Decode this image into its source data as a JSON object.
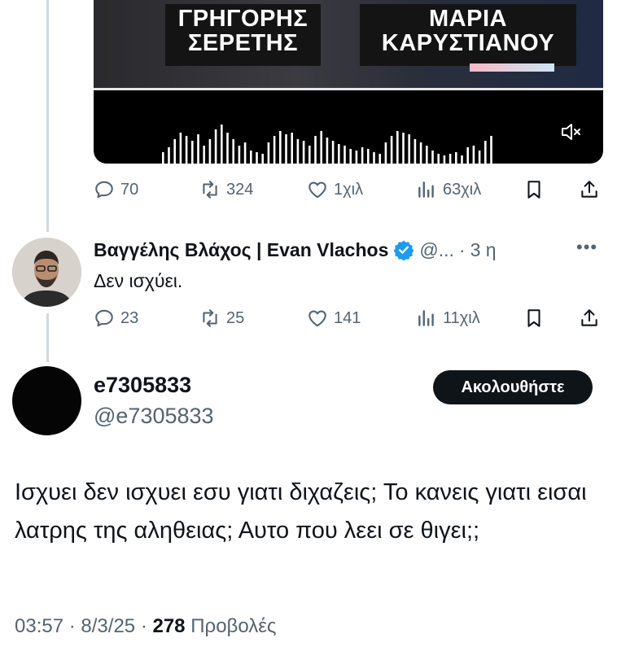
{
  "media": {
    "nameplate_left": [
      "ΓΡΗΓΟΡΗΣ",
      "ΣΕΡΕΤΗΣ"
    ],
    "nameplate_right": [
      "ΜΑΡΙΑ",
      "ΚΑΡΥΣΤΙΑΝΟΥ"
    ],
    "mute_icon": "speaker-muted-icon"
  },
  "quoted_actions": {
    "replies": "70",
    "reposts": "324",
    "likes": "1χιλ",
    "views": "63χιλ"
  },
  "reply": {
    "display_name": "Βαγγέλης Βλάχος | Evan Vlachos",
    "handle": "@...",
    "separator": "·",
    "time": "3 η",
    "text": "Δεν ισχύει.",
    "actions": {
      "replies": "23",
      "reposts": "25",
      "likes": "141",
      "views": "11χιλ"
    }
  },
  "main": {
    "display_name": "e7305833",
    "handle": "@e7305833",
    "follow_label": "Ακολουθήστε",
    "text": "Ισχυει δεν ισχυει εσυ γιατι διχαζεις; Το κανεις γιατι εισαι λατρης της αληθειας; Αυτο που λεει σε θιγει;;",
    "time": "03:57",
    "date": "8/3/25",
    "dot": "·",
    "views_count": "278",
    "views_label": "Προβολές"
  },
  "colors": {
    "verified": "#1d9bf0",
    "secondary_text": "#536471",
    "primary_text": "#0f1419"
  }
}
